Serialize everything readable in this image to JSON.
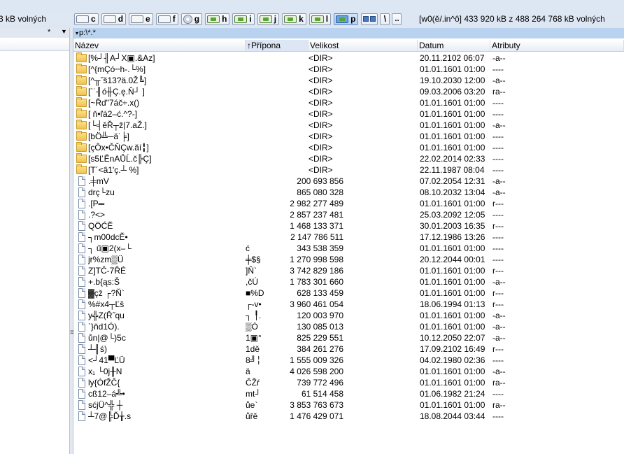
{
  "left_panel": {
    "free_space": "3 kB volných",
    "path_star": "*",
    "path_arrow": "▼"
  },
  "drives": [
    {
      "letter": "c",
      "icon": "hard-drive-icon",
      "active": false
    },
    {
      "letter": "d",
      "icon": "hard-drive-icon",
      "active": false
    },
    {
      "letter": "e",
      "icon": "hard-drive-icon",
      "active": false
    },
    {
      "letter": "f",
      "icon": "hard-drive-icon",
      "active": false
    },
    {
      "letter": "g",
      "icon": "cd-drive-icon",
      "active": false
    },
    {
      "letter": "h",
      "icon": "network-drive-icon",
      "active": false
    },
    {
      "letter": "i",
      "icon": "network-drive-icon",
      "active": false
    },
    {
      "letter": "j",
      "icon": "network-drive-icon",
      "active": false
    },
    {
      "letter": "k",
      "icon": "network-drive-icon",
      "active": false
    },
    {
      "letter": "l",
      "icon": "network-drive-icon",
      "active": false
    },
    {
      "letter": "p",
      "icon": "network-drive-icon",
      "active": true
    }
  ],
  "toolbar": {
    "root_label": "\\",
    "parent_label": ".."
  },
  "drive_info": "[w0(ě/.in^ô]  433 920 kB z 488 264 768 kB volných",
  "right_panel": {
    "path": "p:\\*.*",
    "path_arrow": "▾",
    "columns": {
      "name": "Název",
      "ext": "↑Přípona",
      "size": "Velikost",
      "date": "Datum",
      "attr": "Atributy"
    },
    "rows": [
      {
        "type": "dir",
        "name": "[%┘╢A┘X▣.&Az]",
        "ext": "",
        "size": "<DIR>",
        "date": "20.11.2102 06:07",
        "attr": "-a--"
      },
      {
        "type": "dir",
        "name": "[^{mÇó╌h-.└%]",
        "ext": "",
        "size": "<DIR>",
        "date": "01.01.1601 01:00",
        "attr": "----"
      },
      {
        "type": "dir",
        "name": "[^╥˝š13?ä.0Ž╚]",
        "ext": "",
        "size": "<DIR>",
        "date": "19.10.2030 12:00",
        "attr": "-a--"
      },
      {
        "type": "dir",
        "name": "[`˙╢ó╫Ç.ę.Ň┘ ]",
        "ext": "",
        "size": "<DIR>",
        "date": "09.03.2006 03:20",
        "attr": "ra--"
      },
      {
        "type": "dir",
        "name": "[~Řd\"7áč÷.x()",
        "ext": "",
        "size": "<DIR>",
        "date": "01.01.1601 01:00",
        "attr": "----"
      },
      {
        "type": "dir",
        "name": "[ ň•ľá2–ć.^?-]",
        "ext": "",
        "size": "<DIR>",
        "date": "01.01.1601 01:00",
        "attr": "----"
      },
      {
        "type": "dir",
        "name": "[└╡ěŘ┬ž|7.aŽ.]",
        "ext": "",
        "size": "<DIR>",
        "date": "01.01.1601 01:00",
        "attr": "-a--"
      },
      {
        "type": "dir",
        "name": "[bÖ╩─ä˙╞]",
        "ext": "",
        "size": "<DIR>",
        "date": "01.01.1601 01:00",
        "attr": "----"
      },
      {
        "type": "dir",
        "name": "[çÔx•ČŇÇw.ăí╏]",
        "ext": "",
        "size": "<DIR>",
        "date": "01.01.1601 01:00",
        "attr": "----"
      },
      {
        "type": "dir",
        "name": "[s5ĽĔnAŮĹ.č╠Ç]",
        "ext": "",
        "size": "<DIR>",
        "date": "22.02.2014 02:33",
        "attr": "----"
      },
      {
        "type": "dir",
        "name": "[T´<â1'ç.┴ %]",
        "ext": "",
        "size": "<DIR>",
        "date": "22.11.1987 08:04",
        "attr": "----"
      },
      {
        "type": "file",
        "name": ".╪mV",
        "ext": "",
        "size": "200 693 856",
        "date": "07.02.2054 12:31",
        "attr": "-a--"
      },
      {
        "type": "file",
        "name": "drç└zu",
        "ext": "",
        "size": "865 080 328",
        "date": "08.10.2032 13:04",
        "attr": "-a--"
      },
      {
        "type": "file",
        "name": ".[P═",
        "ext": "",
        "size": "2 982 277 489",
        "date": "01.01.1601 01:00",
        "attr": "r---"
      },
      {
        "type": "file",
        "name": ".?<>",
        "ext": "",
        "size": "2 857 237 481",
        "date": "25.03.2092 12:05",
        "attr": "----"
      },
      {
        "type": "file",
        "name": "QÖĆĔ",
        "ext": "",
        "size": "1 468 133 371",
        "date": "30.01.2003 16:35",
        "attr": "r---"
      },
      {
        "type": "file",
        "name": "┐m00dcĚ•",
        "ext": "",
        "size": "2 147 786 511",
        "date": "17.12.1986 13:26",
        "attr": "----"
      },
      {
        "type": "file",
        "name": "┐ ű▣2(x–└",
        "ext": "ć",
        "size": "343 538 359",
        "date": "01.01.1601 01:00",
        "attr": "----"
      },
      {
        "type": "file",
        "name": "jr%zm▒Ü",
        "ext": "╪$§",
        "size": "1 270 998 598",
        "date": "20.12.2044 00:01",
        "attr": "----"
      },
      {
        "type": "file",
        "name": "Z]TČ-7ŘÉ",
        "ext": "]Ň`",
        "size": "3 742 829 186",
        "date": "01.01.1601 01:00",
        "attr": "r---"
      },
      {
        "type": "file",
        "name": "+.b{ąs:Š",
        "ext": ",čÚ",
        "size": "1 783 301 660",
        "date": "01.01.1601 01:00",
        "attr": "-a--"
      },
      {
        "type": "file",
        "name": "▓çž ┌?Ň`",
        "ext": "■%D",
        "size": "628 133 459",
        "date": "01.01.1601 01:00",
        "attr": "r---"
      },
      {
        "type": "file",
        "name": "%#x4┬Ľš",
        "ext": "┌-v•",
        "size": "3 960 461 054",
        "date": "18.06.1994 01:13",
        "attr": "r---"
      },
      {
        "type": "file",
        "name": "y╬Z(Ř˝qu",
        "ext": "┐ ╿.",
        "size": "120 003 970",
        "date": "01.01.1601 01:00",
        "attr": "-a--"
      },
      {
        "type": "file",
        "name": "`}ňd1Ó).",
        "ext": "▒Ó",
        "size": "130 085 013",
        "date": "01.01.1601 01:00",
        "attr": "-a--"
      },
      {
        "type": "file",
        "name": "ůn|@└)5c",
        "ext": "1▣°",
        "size": "825 229 551",
        "date": "10.12.2050 22:07",
        "attr": "-a--"
      },
      {
        "type": "file",
        "name": "┴╢ś)",
        "ext": "1dě",
        "size": "384 261 276",
        "date": "17.09.2102 16:49",
        "attr": "r---"
      },
      {
        "type": "file",
        "name": "<┘41▀ĽÜ",
        "ext": "8╝╎",
        "size": "1 555 009 326",
        "date": "04.02.1980 02:36",
        "attr": "----"
      },
      {
        "type": "file",
        "name": "x₁ └0j╫N",
        "ext": "ä",
        "size": "4 026 598 200",
        "date": "01.01.1601 01:00",
        "attr": "-a--"
      },
      {
        "type": "file",
        "name": "ly{ÓfŽČ{",
        "ext": "ČŽŕ",
        "size": "739 772 496",
        "date": "01.01.1601 01:00",
        "attr": "ra--"
      },
      {
        "type": "file",
        "name": "cß12–á╩•",
        "ext": "mt┘",
        "size": "61 514 458",
        "date": "01.06.1982 21:24",
        "attr": "----"
      },
      {
        "type": "file",
        "name": "sćjÜ^╬ ┼",
        "ext": "ůe`",
        "size": "3 853 763 673",
        "date": "01.01.1601 01:00",
        "attr": "ra--"
      },
      {
        "type": "file",
        "name": "┴7@╠Ď╁.s",
        "ext": "ůřě",
        "size": "1 476 429 071",
        "date": "18.08.2044 03:44",
        "attr": "----"
      }
    ]
  }
}
